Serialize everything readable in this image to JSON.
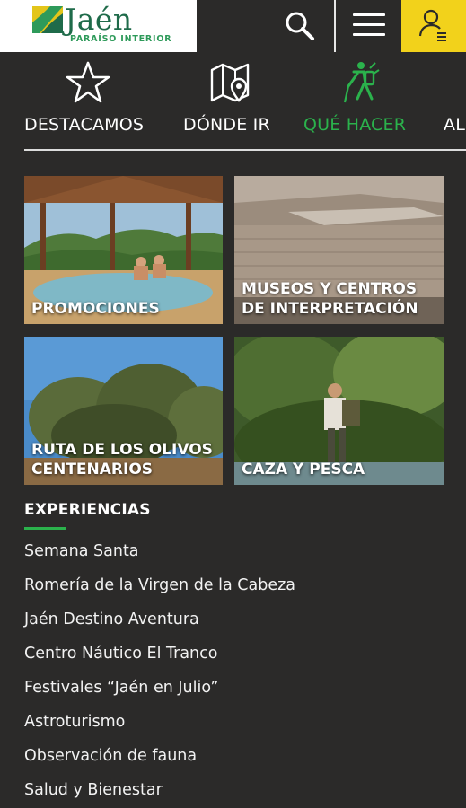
{
  "header": {
    "logo_title": "Jaén",
    "logo_subtitle": "PARAÍSO INTERIOR",
    "brand_colors": {
      "accent_yellow": "#f2d21b",
      "brand_green": "#2bb24c"
    }
  },
  "tabs": [
    {
      "label": "DESTACAMOS",
      "icon": "star-icon",
      "active": false
    },
    {
      "label": "DÓNDE IR",
      "icon": "map-pin-icon",
      "active": false
    },
    {
      "label": "QUÉ HACER",
      "icon": "hiker-icon",
      "active": true
    },
    {
      "label": "AL",
      "icon": "",
      "active": false
    }
  ],
  "cards": [
    {
      "label": "PROMOCIONES"
    },
    {
      "label": "MUSEOS Y CENTROS DE INTERPRETACIÓN"
    },
    {
      "label": "RUTA DE LOS OLIVOS CENTENARIOS"
    },
    {
      "label": "CAZA Y PESCA"
    }
  ],
  "experiences": {
    "title": "EXPERIENCIAS",
    "items": [
      "Semana Santa",
      "Romería de la Virgen de la Cabeza",
      "Jaén Destino Aventura",
      "Centro Náutico El Tranco",
      "Festivales “Jaén en Julio”",
      "Astroturismo",
      "Observación de fauna",
      "Salud y Bienestar"
    ]
  }
}
